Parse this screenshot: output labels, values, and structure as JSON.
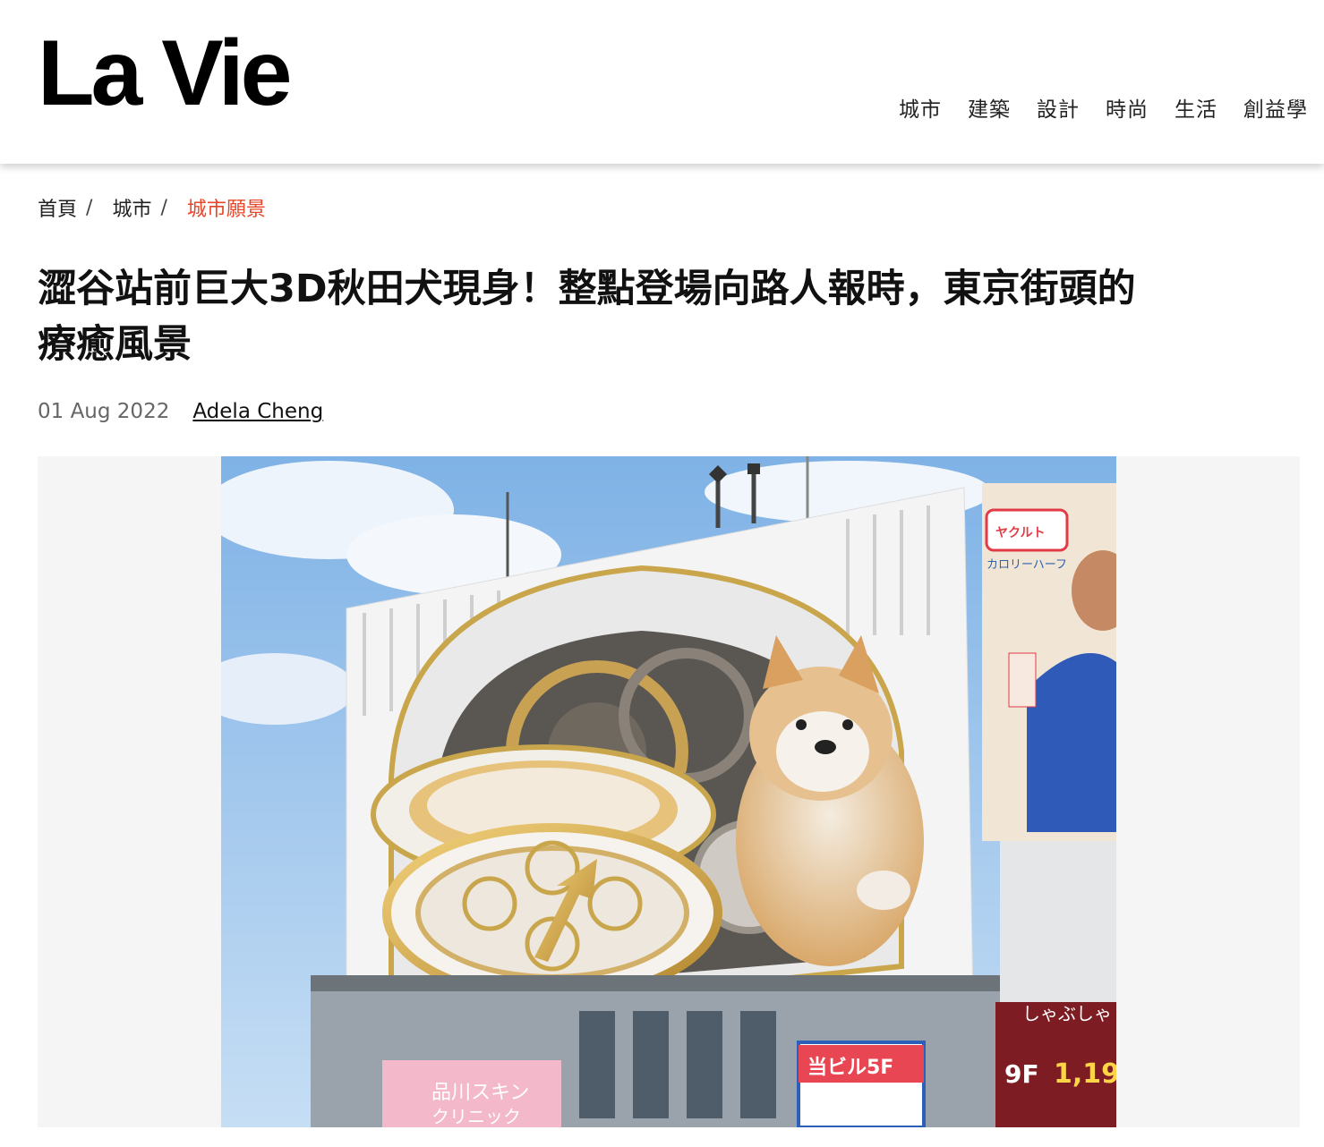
{
  "site": {
    "logo": "La Vie"
  },
  "nav": [
    "城市",
    "建築",
    "設計",
    "時尚",
    "生活",
    "創益學"
  ],
  "breadcrumb": {
    "home": "首頁",
    "category": "城市",
    "current": "城市願景"
  },
  "article": {
    "title_line1": "澀谷站前巨大3D秋田犬現身！整點登場向路人報時，東京街頭的",
    "title_line2": "療癒風景",
    "date": "01 Aug 2022",
    "author": "Adela Cheng"
  },
  "photo_signs": {
    "ad_brand": "ヤクルト",
    "ad_text": "カロリーハーフ",
    "pink_sign": "品川スキン",
    "pink_sign2": "クリニック",
    "blue_sign": "当ビル5F",
    "floor_label": "9F",
    "price": "1,19",
    "shop": "しゃぶしゃ"
  },
  "colors": {
    "accent": "#e8462a",
    "text": "#111111",
    "meta": "#666666"
  }
}
